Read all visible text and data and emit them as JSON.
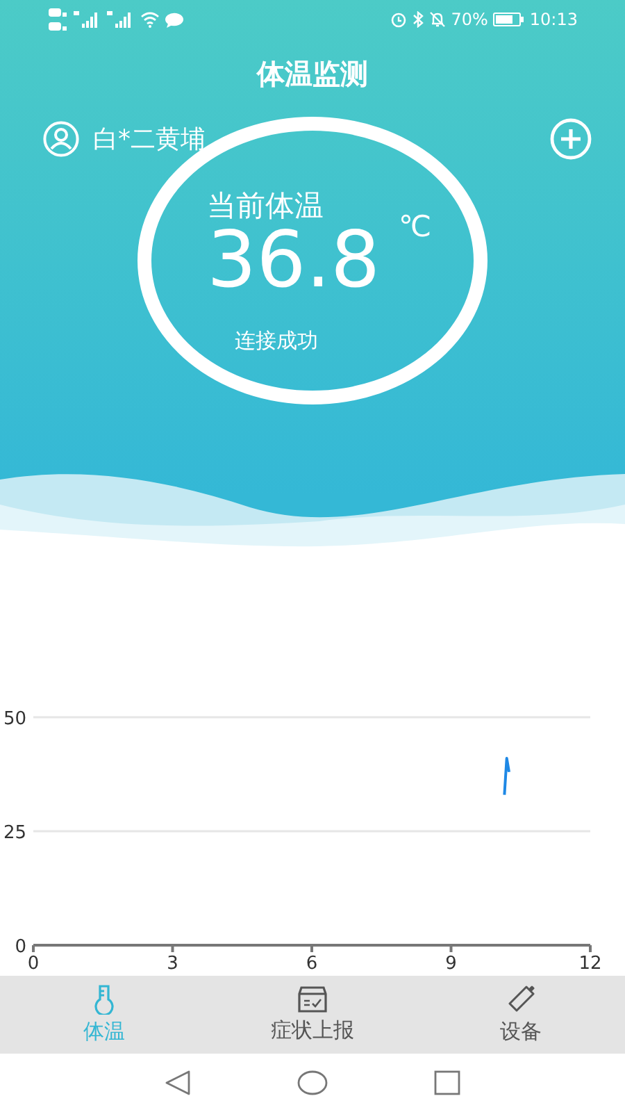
{
  "status_bar": {
    "battery": "70%",
    "time": "10:13"
  },
  "title": "体温监测",
  "user": {
    "name": "白*二黄埔"
  },
  "gauge": {
    "label": "当前体温",
    "value": "36.8",
    "unit": "℃",
    "status": "连接成功"
  },
  "chart_data": {
    "type": "line",
    "x": [
      10.15,
      10.2,
      10.25
    ],
    "series": [
      {
        "color": "#1e88e5",
        "values": [
          33,
          41,
          38
        ]
      }
    ],
    "xlim": [
      0,
      12
    ],
    "ylim": [
      0,
      50
    ],
    "xticks": [
      0,
      3,
      6,
      9,
      12
    ],
    "yticks": [
      0,
      25,
      50
    ]
  },
  "tabs": [
    {
      "label": "体温",
      "selected": true,
      "kind": "thermometer"
    },
    {
      "label": "症状上报",
      "selected": false,
      "kind": "report"
    },
    {
      "label": "设备",
      "selected": false,
      "kind": "device"
    }
  ]
}
